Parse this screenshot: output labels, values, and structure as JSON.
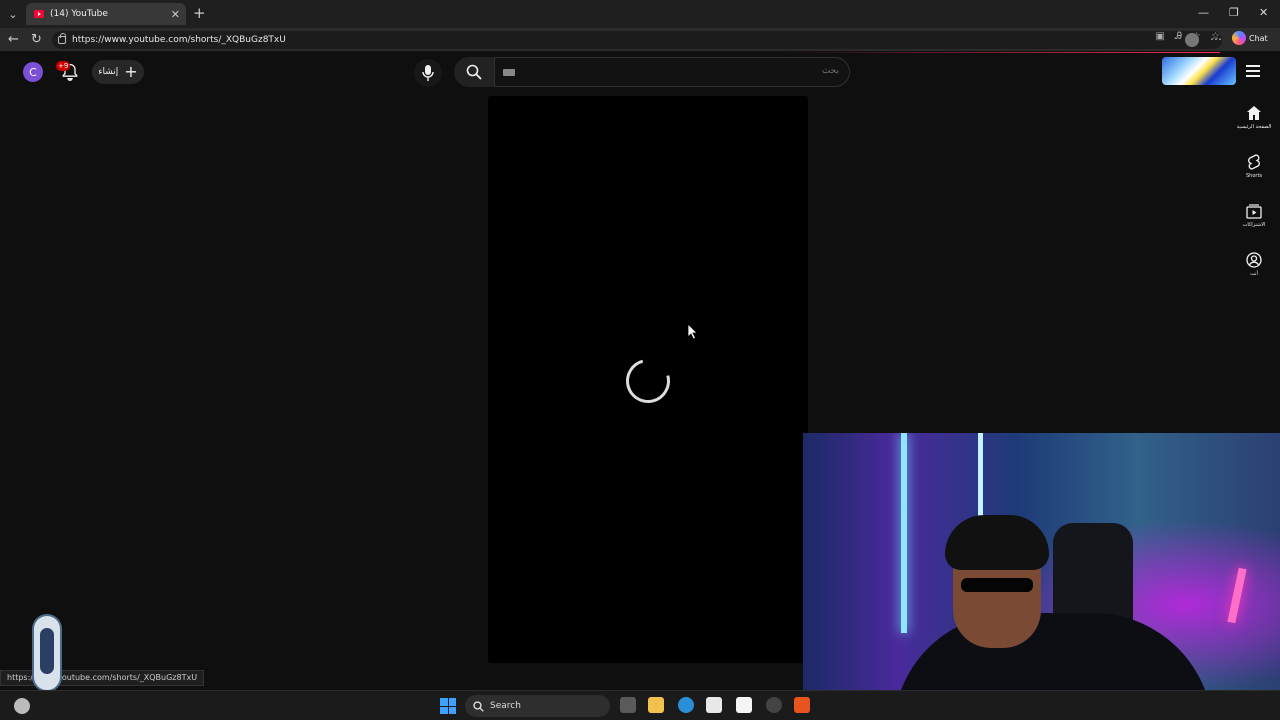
{
  "browser": {
    "tab_title": "(14) YouTube",
    "tab_close": "✕",
    "new_tab": "+",
    "url": "https://www.youtube.com/shorts/_XQBuGz8TxU",
    "chat_label": "Chat",
    "window_controls": {
      "minimize": "—",
      "restore": "❐",
      "close": "✕"
    },
    "status_url": "https://www.youtube.com/shorts/_XQBuGz8TxU"
  },
  "youtube": {
    "avatar_letter": "C",
    "notification_badge": "+9",
    "create_label": "إنشاء",
    "search_placeholder": "بحث",
    "sidebar": [
      {
        "label": "الصفحة الرئيسية",
        "icon": "home-icon"
      },
      {
        "label": "Shorts",
        "icon": "shorts-icon"
      },
      {
        "label": "الاشتراكات",
        "icon": "subscriptions-icon"
      },
      {
        "label": "أنت",
        "icon": "you-icon"
      }
    ],
    "player_state": "loading"
  },
  "taskbar": {
    "search_label": "Search"
  },
  "colors": {
    "youtube_red": "#ff0033",
    "background": "#0f0f0f",
    "avatar": "#7b4fd6"
  }
}
